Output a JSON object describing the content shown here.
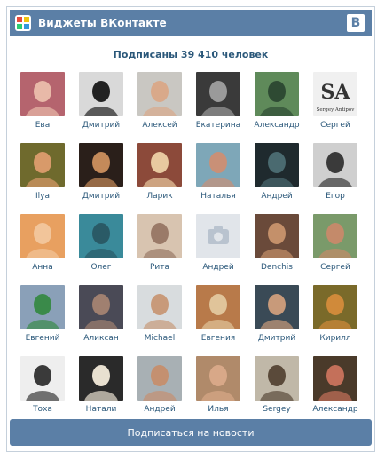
{
  "header": {
    "title": "Виджеты ВКонтакте",
    "logo_text": "В",
    "app_icon": "widget-app-icon"
  },
  "subscribers_text": "Подписаны 39 410 человек",
  "colors": {
    "brand": "#5b7fa6",
    "link": "#2b587a",
    "border": "#c5d0db"
  },
  "people": [
    {
      "name": "Ева",
      "bg": "#b5646e",
      "fg": "#e8b9a8"
    },
    {
      "name": "Дмитрий",
      "bg": "#d9d9d9",
      "fg": "#222222"
    },
    {
      "name": "Алексей",
      "bg": "#c9c7c2",
      "fg": "#d9a98a"
    },
    {
      "name": "Екатерина",
      "bg": "#3a3a3a",
      "fg": "#9a9a9a"
    },
    {
      "name": "Александр",
      "bg": "#5f8a5a",
      "fg": "#2e4a33"
    },
    {
      "name": "Сергей",
      "bg": "#f0f0f0",
      "fg": "#333333",
      "text": "SA",
      "caption": "Sergey Antipov"
    },
    {
      "name": "Ilya",
      "bg": "#6f6a2d",
      "fg": "#d89a6a"
    },
    {
      "name": "Дмитрий",
      "bg": "#2a1f1a",
      "fg": "#c48a5a"
    },
    {
      "name": "Ларик",
      "bg": "#8c4a3a",
      "fg": "#e8c9a0"
    },
    {
      "name": "Наталья",
      "bg": "#7ea7b8",
      "fg": "#c99077"
    },
    {
      "name": "Андрей",
      "bg": "#1f2a2e",
      "fg": "#4a6a70"
    },
    {
      "name": "Егор",
      "bg": "#cfcfcf",
      "fg": "#3a3a3a"
    },
    {
      "name": "Анна",
      "bg": "#e8a060",
      "fg": "#f2c59a"
    },
    {
      "name": "Олег",
      "bg": "#3a8a9a",
      "fg": "#2a5a66"
    },
    {
      "name": "Рита",
      "bg": "#d8c4b0",
      "fg": "#9a7a68"
    },
    {
      "name": "Андрей",
      "bg": "#e1e5ea",
      "fg": "#b9c3cf",
      "placeholder": true
    },
    {
      "name": "Denchis",
      "bg": "#6a4a3a",
      "fg": "#c4906a"
    },
    {
      "name": "Сергей",
      "bg": "#7a9a6a",
      "fg": "#c48a6a"
    },
    {
      "name": "Евгений",
      "bg": "#8aa0b8",
      "fg": "#3a8a4a"
    },
    {
      "name": "Аликсан",
      "bg": "#4a4a56",
      "fg": "#a08070"
    },
    {
      "name": "Michael",
      "bg": "#d8dcde",
      "fg": "#c89a7a"
    },
    {
      "name": "Евгения",
      "bg": "#b87a4a",
      "fg": "#e0c49a"
    },
    {
      "name": "Дмитрий",
      "bg": "#3a4a56",
      "fg": "#c89a7a"
    },
    {
      "name": "Кирилл",
      "bg": "#7a6a2a",
      "fg": "#d08a3a"
    },
    {
      "name": "Тоха",
      "bg": "#eeeeee",
      "fg": "#3a3a3a"
    },
    {
      "name": "Натали",
      "bg": "#2a2a2a",
      "fg": "#e8e0d0"
    },
    {
      "name": "Андрей",
      "bg": "#a8b0b4",
      "fg": "#c49070"
    },
    {
      "name": "Илья",
      "bg": "#b08a6a",
      "fg": "#d8a888"
    },
    {
      "name": "Sergey",
      "bg": "#c0b8a8",
      "fg": "#5a4a3a"
    },
    {
      "name": "Александр",
      "bg": "#4a3a2a",
      "fg": "#c4705a"
    }
  ],
  "subscribe_button": "Подписаться на новости"
}
